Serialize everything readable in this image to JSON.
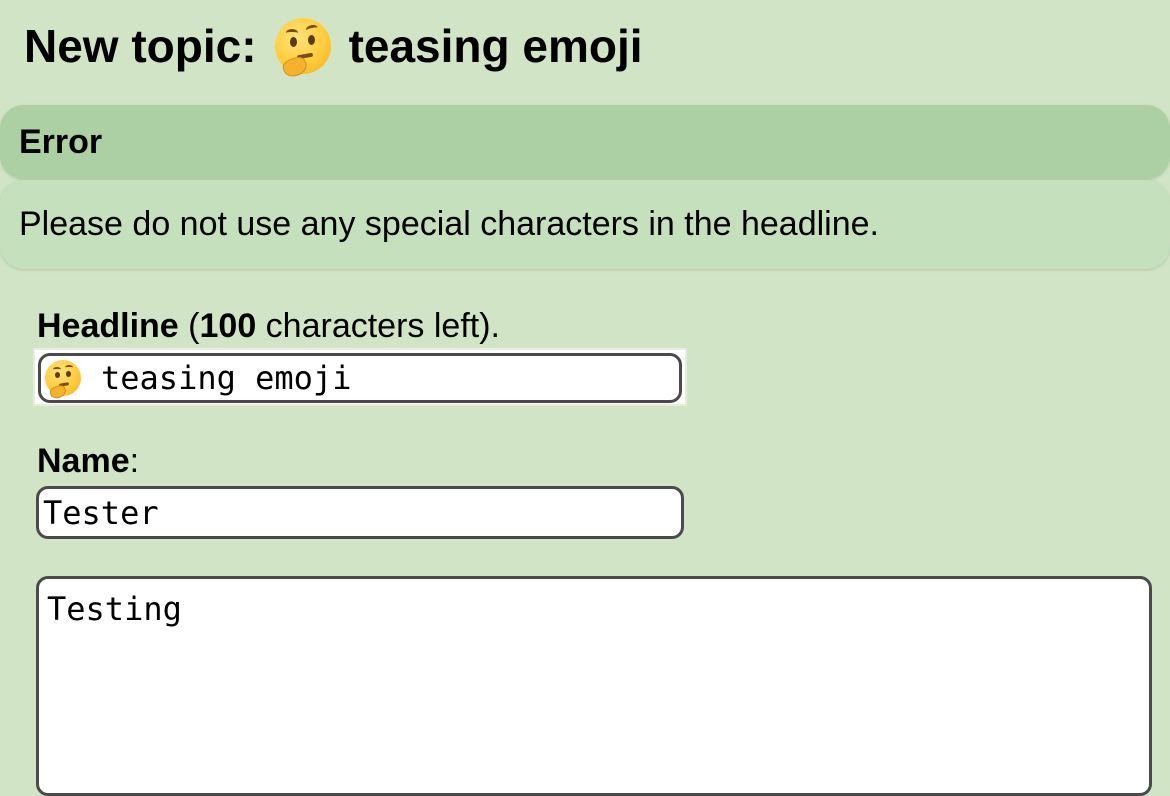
{
  "page": {
    "title_prefix": "New topic:",
    "title_text": "teasing emoji",
    "title_emoji_icon": "thinking-face-icon"
  },
  "error": {
    "heading": "Error",
    "message": "Please do not use any special characters in the headline."
  },
  "form": {
    "headline": {
      "label": "Headline",
      "counter_open": " (",
      "chars_left": "100",
      "counter_close": " characters left).",
      "value_text": "teasing emoji",
      "value_emoji_icon": "thinking-face-icon"
    },
    "name": {
      "label": "Name",
      "suffix": ":",
      "value": "Tester"
    },
    "body": {
      "value": "Testing"
    }
  },
  "colors": {
    "background": "#d1e5c6",
    "error_header": "#acd0a4",
    "error_body": "#c5e0bd",
    "input_border": "#4a4a4a"
  }
}
